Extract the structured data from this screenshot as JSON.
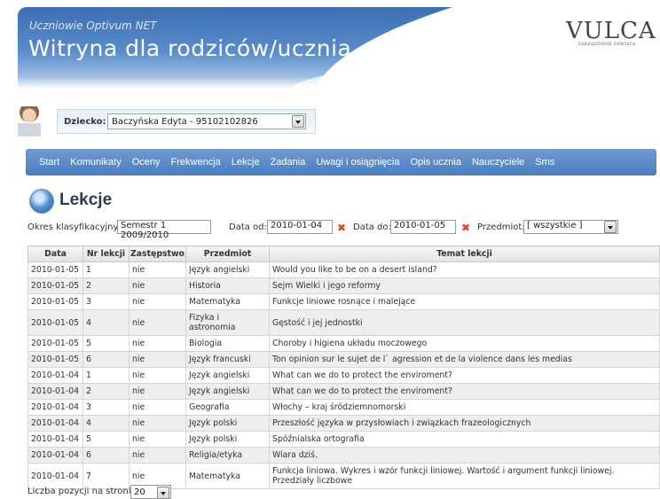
{
  "header": {
    "subtitle": "Uczniowie Optivum NET",
    "title": "Witryna dla rodziców/ucznia",
    "logo_text": "VULCAN",
    "logo_tagline": "ZARZĄDZANIE OŚWIATĄ"
  },
  "child": {
    "label": "Dziecko:",
    "selected": "Baczyńska Edyta - 95102102826"
  },
  "nav": {
    "items": [
      "Start",
      "Komunikaty",
      "Oceny",
      "Frekwencja",
      "Lekcje",
      "Zadania",
      "Uwagi i osiągnięcia",
      "Opis ucznia",
      "Nauczyciele",
      "Sms"
    ]
  },
  "page": {
    "title": "Lekcje"
  },
  "filters": {
    "period_label": "Okres klasyfikacyjny:",
    "period_value": "Semestr 1 2009/2010",
    "date_from_label": "Data od:",
    "date_from_value": "2010-01-04",
    "date_to_label": "Data do:",
    "date_to_value": "2010-01-05",
    "subject_label": "Przedmiot:",
    "subject_value": "[ wszystkie ]"
  },
  "table": {
    "headers": [
      "Data",
      "Nr lekcji",
      "Zastępstwo",
      "Przedmiot",
      "Temat lekcji"
    ],
    "rows": [
      [
        "2010-01-05",
        "1",
        "nie",
        "Język angielski",
        "Would you like to be on a desert island?"
      ],
      [
        "2010-01-05",
        "2",
        "nie",
        "Historia",
        "Sejm Wielki i jego reformy"
      ],
      [
        "2010-01-05",
        "3",
        "nie",
        "Matematyka",
        "Funkcje liniowe rosnące i malejące"
      ],
      [
        "2010-01-05",
        "4",
        "nie",
        "Fizyka i astronomia",
        "Gęstość i jej jednostki"
      ],
      [
        "2010-01-05",
        "5",
        "nie",
        "Biologia",
        "Choroby i higiena układu moczowego"
      ],
      [
        "2010-01-05",
        "6",
        "nie",
        "Język francuski",
        "Ton opinion sur le sujet de l` agression et de la violence dans les medias"
      ],
      [
        "2010-01-04",
        "1",
        "nie",
        "Język angielski",
        "What can we do to protect the enviroment?"
      ],
      [
        "2010-01-04",
        "2",
        "nie",
        "Język angielski",
        "What can we do to protect the enviroment?"
      ],
      [
        "2010-01-04",
        "3",
        "nie",
        "Geografia",
        "Włochy – kraj śródziemnomorski"
      ],
      [
        "2010-01-04",
        "4",
        "nie",
        "Język polski",
        "Przeszłość języka w przysłowiach i związkach frazeologicznych"
      ],
      [
        "2010-01-04",
        "5",
        "nie",
        "Język polski",
        "Spóźnialska ortografia"
      ],
      [
        "2010-01-04",
        "6",
        "nie",
        "Religia/etyka",
        "Wiara dziś."
      ],
      [
        "2010-01-04",
        "7",
        "nie",
        "Matematyka",
        "Funkcja liniowa. Wykres i wzór funkcji liniowej. Wartość i argument funkcji liniowej. Przedziały liczbowe"
      ]
    ]
  },
  "footer": {
    "page_size_label": "Liczba pozycji na stronie:",
    "page_size_value": "20"
  },
  "colors": {
    "nav_bg": "#4a7dbf",
    "header_blue": "#3b6fb3",
    "clear_icon": "#d9471a",
    "row_alt": "#eeeeee"
  }
}
